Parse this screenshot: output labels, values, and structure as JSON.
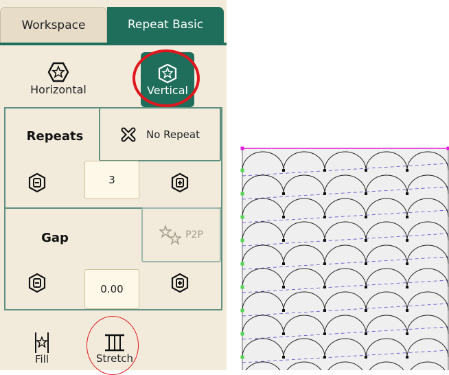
{
  "tabs": {
    "workspace": "Workspace",
    "repeat_basic": "Repeat Basic"
  },
  "orientation": {
    "horizontal": "Horizontal",
    "vertical": "Vertical"
  },
  "repeats": {
    "label": "Repeats",
    "no_repeat": "No Repeat",
    "value": "3"
  },
  "gap": {
    "label": "Gap",
    "p2p": "P2P",
    "value": "0.00"
  },
  "bottom": {
    "fill": "Fill",
    "stretch": "Stretch"
  },
  "colors": {
    "accent": "#1f6e5c",
    "panel": "#f2ebdc",
    "highlight": "#e0161d",
    "guide": "#6a5acd",
    "boundary": "#e21bd8"
  }
}
